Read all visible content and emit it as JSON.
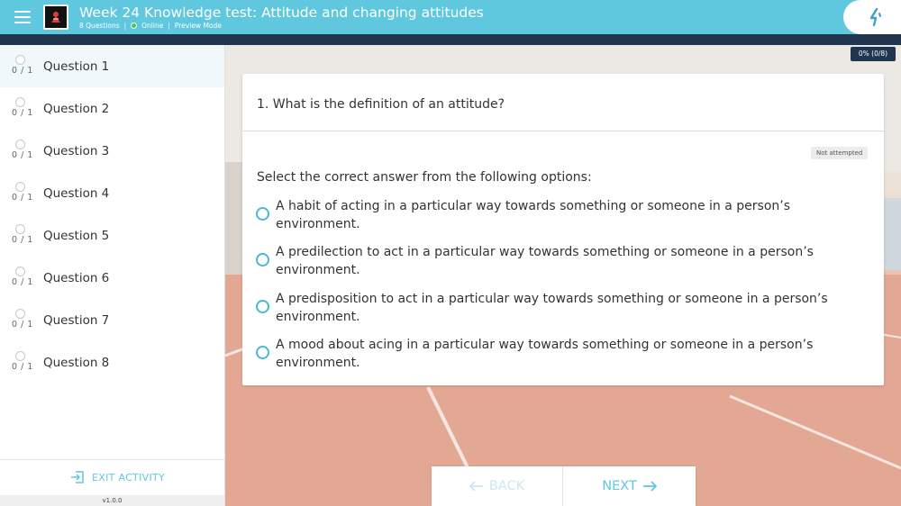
{
  "header": {
    "menu_icon": "hamburger-menu-icon",
    "logo_icon": "course-logo-icon",
    "title": "Week 24 Knowledge test: Attitude and changing attitudes",
    "meta": {
      "questions": "8 Questions",
      "separator": "|",
      "online": "Online",
      "mode": "Preview Mode"
    },
    "brand_icon": "brand-logo-icon",
    "accent_color": "#5fc8df",
    "dark_color": "#1f3550"
  },
  "progress": {
    "label": "0% (0/8)",
    "fraction": 0
  },
  "sidebar": {
    "items": [
      {
        "score": "0 / 1",
        "label": "Question 1",
        "active": true
      },
      {
        "score": "0 / 1",
        "label": "Question 2"
      },
      {
        "score": "0 / 1",
        "label": "Question 3"
      },
      {
        "score": "0 / 1",
        "label": "Question 4"
      },
      {
        "score": "0 / 1",
        "label": "Question 5"
      },
      {
        "score": "0 / 1",
        "label": "Question 6"
      },
      {
        "score": "0 / 1",
        "label": "Question 7"
      },
      {
        "score": "0 / 1",
        "label": "Question 8"
      }
    ],
    "exit_label": "EXIT ACTIVITY",
    "exit_icon": "exit-icon",
    "version": "v1.0.0"
  },
  "question": {
    "title": "1. What is the definition of an attitude?",
    "status": "Not attempted",
    "instructions": "Select the correct answer from the following options:",
    "options": [
      "A habit of acting in a particular way towards something or someone in a person’s environment.",
      "A predilection to act in a particular way towards something or someone in a person’s environment.",
      "A predisposition to act in a particular way towards something or someone in a person’s environment.",
      "A mood about acing in a particular way towards something or someone in a person’s environment."
    ]
  },
  "nav": {
    "back_label": "BACK",
    "back_icon": "arrow-left-icon",
    "next_label": "NEXT",
    "next_icon": "arrow-right-icon"
  }
}
